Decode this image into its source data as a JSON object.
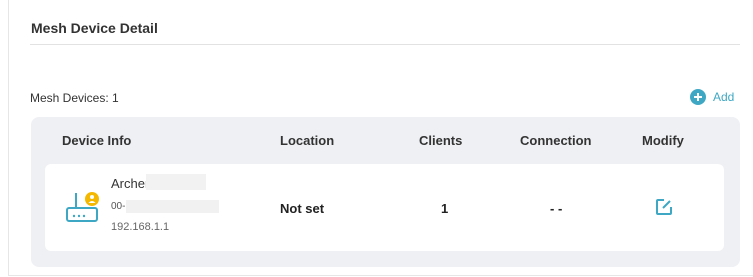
{
  "section": {
    "title": "Mesh Device Detail",
    "count_label": "Mesh Devices: 1",
    "add_label": "Add"
  },
  "table": {
    "headers": {
      "device_info": "Device Info",
      "location": "Location",
      "clients": "Clients",
      "connection": "Connection",
      "modify": "Modify"
    },
    "rows": [
      {
        "name": "Archer",
        "mac": "00-FF",
        "ip": "192.168.1.1",
        "location": "Not set",
        "clients": "1",
        "connection": "- -",
        "modify_icon": "edit-icon"
      }
    ]
  },
  "colors": {
    "accent": "#3ea8c4",
    "badge": "#f5b800",
    "panel_bg": "#eef0f3"
  }
}
